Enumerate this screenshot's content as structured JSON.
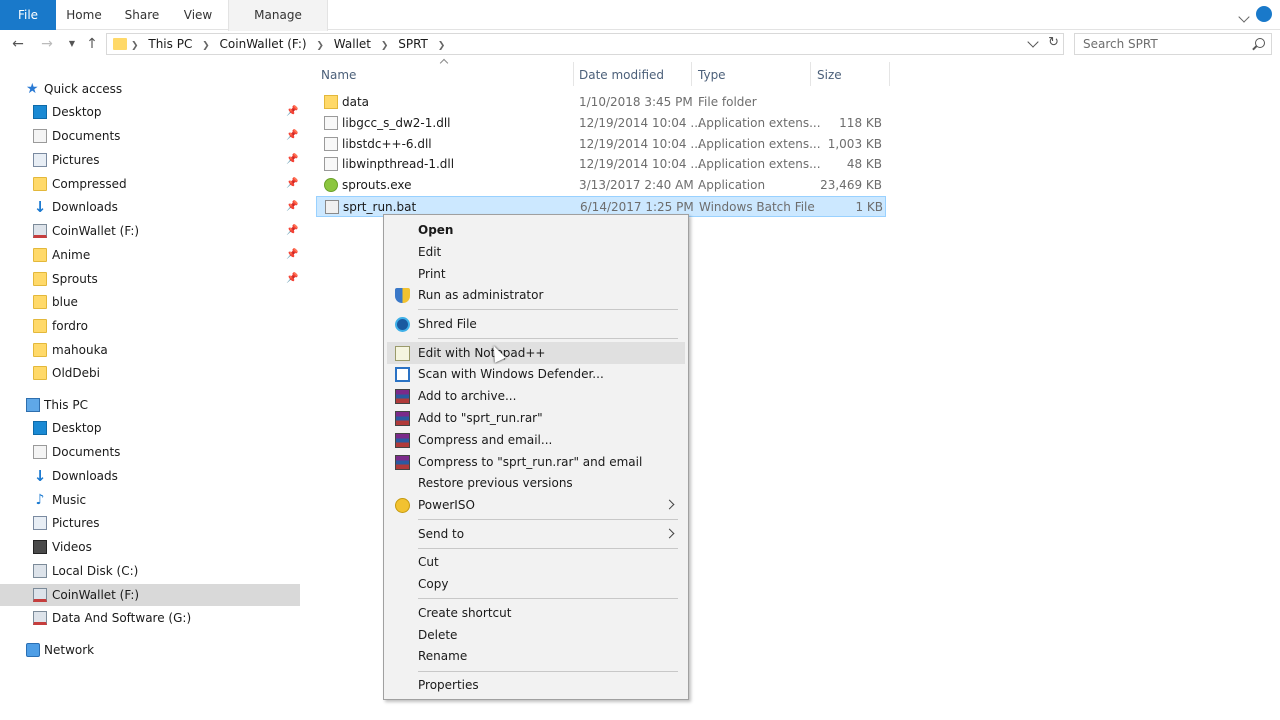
{
  "ribbon": {
    "tabs": [
      {
        "label": "File"
      },
      {
        "label": "Home"
      },
      {
        "label": "Share"
      },
      {
        "label": "View"
      },
      {
        "label": "Manage"
      }
    ]
  },
  "address": {
    "crumbs": [
      "This PC",
      "CoinWallet (F:)",
      "Wallet",
      "SPRT"
    ],
    "search_placeholder": "Search SPRT"
  },
  "sidebar": {
    "quick_access": {
      "label": "Quick access",
      "icon": "star-icon"
    },
    "quick_items": [
      {
        "label": "Desktop",
        "icon": "desktop-icon",
        "pinned": true
      },
      {
        "label": "Documents",
        "icon": "documents-icon",
        "pinned": true
      },
      {
        "label": "Pictures",
        "icon": "pictures-icon",
        "pinned": true
      },
      {
        "label": "Compressed",
        "icon": "folder-icon",
        "pinned": true
      },
      {
        "label": "Downloads",
        "icon": "downloads-icon",
        "pinned": true
      },
      {
        "label": "CoinWallet (F:)",
        "icon": "drive-icon",
        "pinned": true
      },
      {
        "label": "Anime",
        "icon": "folder-icon",
        "pinned": true
      },
      {
        "label": "Sprouts",
        "icon": "folder-icon",
        "pinned": true
      },
      {
        "label": "blue",
        "icon": "folder-icon",
        "pinned": false
      },
      {
        "label": "fordro",
        "icon": "folder-icon",
        "pinned": false
      },
      {
        "label": "mahouka",
        "icon": "folder-icon",
        "pinned": false
      },
      {
        "label": "OldDebi",
        "icon": "folder-icon",
        "pinned": false
      }
    ],
    "this_pc": {
      "label": "This PC",
      "icon": "computer-icon"
    },
    "pc_items": [
      {
        "label": "Desktop",
        "icon": "desktop-icon"
      },
      {
        "label": "Documents",
        "icon": "documents-icon"
      },
      {
        "label": "Downloads",
        "icon": "downloads-icon"
      },
      {
        "label": "Music",
        "icon": "music-icon"
      },
      {
        "label": "Pictures",
        "icon": "pictures-icon"
      },
      {
        "label": "Videos",
        "icon": "videos-icon"
      },
      {
        "label": "Local Disk (C:)",
        "icon": "drive-icon"
      },
      {
        "label": "CoinWallet (F:)",
        "icon": "drive-icon",
        "selected": true
      },
      {
        "label": "Data And Software (G:)",
        "icon": "drive-icon"
      }
    ],
    "network": {
      "label": "Network",
      "icon": "network-icon"
    }
  },
  "columns": {
    "name": "Name",
    "date": "Date modified",
    "type": "Type",
    "size": "Size"
  },
  "files": [
    {
      "name": "data",
      "date": "1/10/2018 3:45 PM",
      "type": "File folder",
      "size": "",
      "icon": "folder-icon"
    },
    {
      "name": "libgcc_s_dw2-1.dll",
      "date": "12/19/2014 10:04 ...",
      "type": "Application extens...",
      "size": "118 KB",
      "icon": "dll-icon"
    },
    {
      "name": "libstdc++-6.dll",
      "date": "12/19/2014 10:04 ...",
      "type": "Application extens...",
      "size": "1,003 KB",
      "icon": "dll-icon"
    },
    {
      "name": "libwinpthread-1.dll",
      "date": "12/19/2014 10:04 ...",
      "type": "Application extens...",
      "size": "48 KB",
      "icon": "dll-icon"
    },
    {
      "name": "sprouts.exe",
      "date": "3/13/2017 2:40 AM",
      "type": "Application",
      "size": "23,469 KB",
      "icon": "sprouts-app-icon"
    },
    {
      "name": "sprt_run.bat",
      "date": "6/14/2017 1:25 PM",
      "type": "Windows Batch File",
      "size": "1 KB",
      "icon": "batch-file-icon",
      "selected": true
    }
  ],
  "context_menu": {
    "items": [
      {
        "label": "Open",
        "bold": true
      },
      {
        "label": "Edit"
      },
      {
        "label": "Print"
      },
      {
        "label": "Run as administrator",
        "icon": "uac-shield-icon"
      },
      {
        "label": "Shred File",
        "icon": "shred-icon"
      },
      {
        "label": "Edit with Notepad++",
        "icon": "notepad-plus-plus-icon",
        "hover": true
      },
      {
        "label": "Scan with Windows Defender...",
        "icon": "windows-defender-icon"
      },
      {
        "label": "Add to archive...",
        "icon": "winrar-icon"
      },
      {
        "label": "Add to \"sprt_run.rar\"",
        "icon": "winrar-icon"
      },
      {
        "label": "Compress and email...",
        "icon": "winrar-icon"
      },
      {
        "label": "Compress to \"sprt_run.rar\" and email",
        "icon": "winrar-icon"
      },
      {
        "label": "Restore previous versions"
      },
      {
        "label": "PowerISO",
        "icon": "poweriso-icon",
        "submenu": true
      },
      {
        "label": "Send to",
        "submenu": true
      },
      {
        "label": "Cut"
      },
      {
        "label": "Copy"
      },
      {
        "label": "Create shortcut"
      },
      {
        "label": "Delete"
      },
      {
        "label": "Rename"
      },
      {
        "label": "Properties"
      }
    ]
  }
}
